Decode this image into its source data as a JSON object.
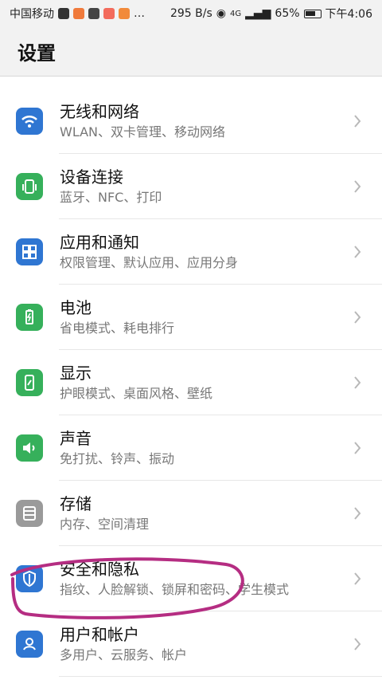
{
  "status_bar": {
    "carrier": "中国移动",
    "net_speed": "295 B/s",
    "signal": "4G",
    "battery_percent": "65%",
    "time": "下午4:06",
    "icons": [
      "app-notification-icon",
      "eye-icon",
      "signal-icon",
      "battery-icon"
    ]
  },
  "header": {
    "title": "设置"
  },
  "settings": [
    {
      "title": "无线和网络",
      "subtitle": "WLAN、双卡管理、移动网络",
      "icon": "wifi-icon",
      "color": "#2f76d2"
    },
    {
      "title": "设备连接",
      "subtitle": "蓝牙、NFC、打印",
      "icon": "device-connection-icon",
      "color": "#36b05b"
    },
    {
      "title": "应用和通知",
      "subtitle": "权限管理、默认应用、应用分身",
      "icon": "apps-icon",
      "color": "#2f76d2"
    },
    {
      "title": "电池",
      "subtitle": "省电模式、耗电排行",
      "icon": "battery-icon",
      "color": "#36b05b"
    },
    {
      "title": "显示",
      "subtitle": "护眼模式、桌面风格、壁纸",
      "icon": "display-icon",
      "color": "#36b05b"
    },
    {
      "title": "声音",
      "subtitle": "免打扰、铃声、振动",
      "icon": "sound-icon",
      "color": "#36b05b"
    },
    {
      "title": "存储",
      "subtitle": "内存、空间清理",
      "icon": "storage-icon",
      "color": "#9a9a9a"
    },
    {
      "title": "安全和隐私",
      "subtitle": "指纹、人脸解锁、锁屏和密码、学生模式",
      "icon": "shield-icon",
      "color": "#2f76d2"
    },
    {
      "title": "用户和帐户",
      "subtitle": "多用户、云服务、帐户",
      "icon": "user-icon",
      "color": "#2f76d2"
    }
  ],
  "colors": {
    "highlight": "#b52d82",
    "chevron": "#b8b8b8",
    "background": "#f2f2f2"
  }
}
